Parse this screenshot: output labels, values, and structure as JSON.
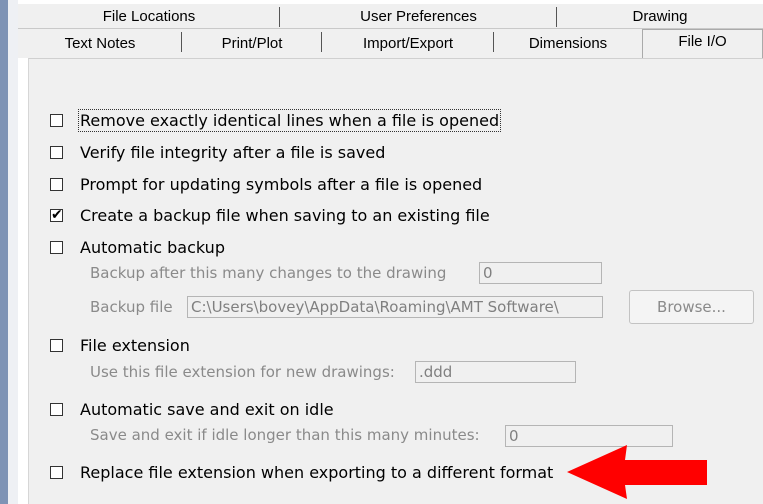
{
  "tabs": {
    "row1": [
      "File Locations",
      "User Preferences",
      "Drawing"
    ],
    "row2": [
      "Text Notes",
      "Print/Plot",
      "Import/Export",
      "Dimensions",
      "File I/O"
    ],
    "active": "File I/O"
  },
  "options": {
    "remove_identical": {
      "label": "Remove exactly identical lines when a file is opened",
      "checked": false
    },
    "verify_integrity": {
      "label": "Verify file integrity after a file is saved",
      "checked": false
    },
    "prompt_symbols": {
      "label": "Prompt for updating symbols after a file is opened",
      "checked": false
    },
    "backup_file": {
      "label": "Create a backup file when saving to an existing file",
      "checked": true,
      "check_glyph": "✔"
    },
    "automatic_backup": {
      "label": "Automatic backup",
      "checked": false,
      "changes_label": "Backup after this many changes to the drawing",
      "changes_value": "0",
      "file_label": "Backup file",
      "file_value": "C:\\Users\\bovey\\AppData\\Roaming\\AMT Software\\",
      "browse_label": "Browse..."
    },
    "file_extension": {
      "label": "File extension",
      "checked": false,
      "ext_label": "Use this file extension for new drawings:",
      "ext_value": ".ddd"
    },
    "auto_save": {
      "label": "Automatic save and exit on idle",
      "checked": false,
      "minutes_label": "Save and exit if idle longer than this many minutes:",
      "minutes_value": "0"
    },
    "replace_extension": {
      "label": "Replace file extension when exporting to a different format",
      "checked": false
    }
  },
  "annotation": {
    "arrow_color": "#ff0000",
    "arrow_icon": "red-arrow-left"
  }
}
